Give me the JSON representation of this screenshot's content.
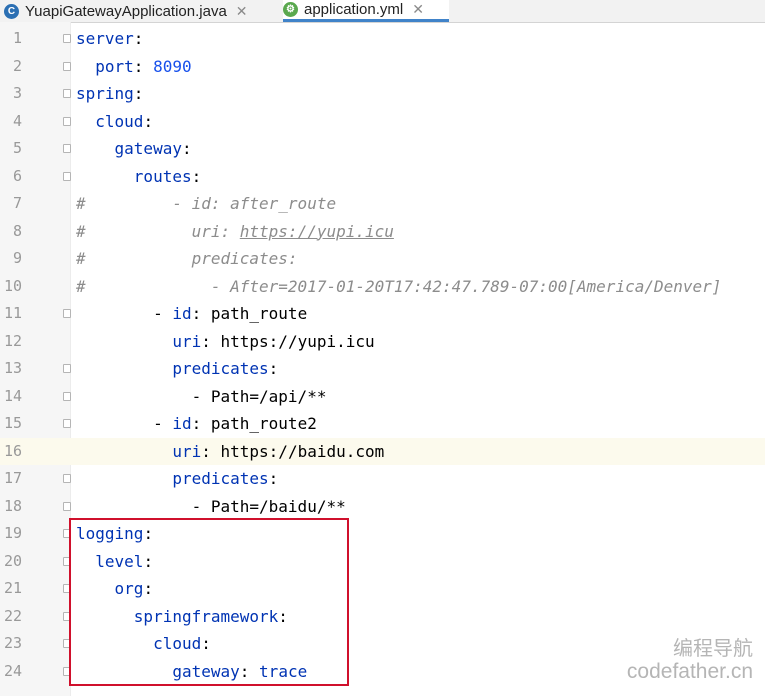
{
  "tabs": [
    {
      "label": "YuapiGatewayApplication.java",
      "icon": "java-class-icon",
      "active": false
    },
    {
      "label": "application.yml",
      "icon": "yaml-file-icon",
      "active": true
    }
  ],
  "editor": {
    "current_line": 16,
    "lines": [
      {
        "n": "1",
        "text": "server:"
      },
      {
        "n": "2",
        "text": "  port: 8090"
      },
      {
        "n": "3",
        "text": "spring:"
      },
      {
        "n": "4",
        "text": "  cloud:"
      },
      {
        "n": "5",
        "text": "    gateway:"
      },
      {
        "n": "6",
        "text": "      routes:"
      },
      {
        "n": "7",
        "text": "#         - id: after_route"
      },
      {
        "n": "8",
        "text": "#           uri: https://yupi.icu"
      },
      {
        "n": "9",
        "text": "#           predicates:"
      },
      {
        "n": "10",
        "text": "#             - After=2017-01-20T17:42:47.789-07:00[America/Denver]"
      },
      {
        "n": "11",
        "text": "        - id: path_route"
      },
      {
        "n": "12",
        "text": "          uri: https://yupi.icu"
      },
      {
        "n": "13",
        "text": "          predicates:"
      },
      {
        "n": "14",
        "text": "            - Path=/api/**"
      },
      {
        "n": "15",
        "text": "        - id: path_route2"
      },
      {
        "n": "16",
        "text": "          uri: https://baidu.com"
      },
      {
        "n": "17",
        "text": "          predicates:"
      },
      {
        "n": "18",
        "text": "            - Path=/baidu/**"
      },
      {
        "n": "19",
        "text": "logging:"
      },
      {
        "n": "20",
        "text": "  level:"
      },
      {
        "n": "21",
        "text": "    org:"
      },
      {
        "n": "22",
        "text": "      springframework:"
      },
      {
        "n": "23",
        "text": "        cloud:"
      },
      {
        "n": "24",
        "text": "          gateway: trace"
      }
    ]
  },
  "watermark": {
    "line1": "编程导航",
    "line2": "codefather.cn"
  },
  "colors": {
    "key": "#0033b3",
    "number": "#1750eb",
    "comment": "#8c8c8c",
    "highlight_box": "#d0102c",
    "active_tab_underline": "#4083c9"
  }
}
